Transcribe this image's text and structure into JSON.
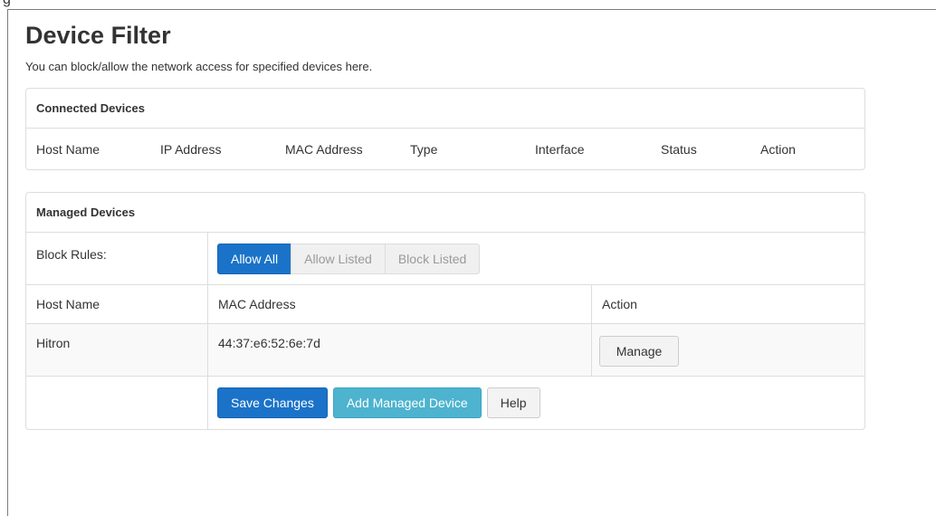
{
  "header": {
    "fragment_text": "g",
    "title": "Device Filter",
    "description": "You can block/allow the network access for specified devices here."
  },
  "connected": {
    "title": "Connected Devices",
    "columns": [
      "Host Name",
      "IP Address",
      "MAC Address",
      "Type",
      "Interface",
      "Status",
      "Action"
    ]
  },
  "managed": {
    "title": "Managed Devices",
    "block_rules_label": "Block Rules:",
    "block_rules_options": [
      "Allow All",
      "Allow Listed",
      "Block Listed"
    ],
    "block_rules_selected": "Allow All",
    "columns": [
      "Host Name",
      "MAC Address",
      "Action"
    ],
    "rows": [
      {
        "host_name": "Hitron",
        "mac": "44:37:e6:52:6e:7d",
        "action_label": "Manage"
      }
    ],
    "buttons": {
      "save": "Save Changes",
      "add": "Add Managed Device",
      "help": "Help"
    }
  },
  "colors": {
    "primary": "#1a73c8",
    "info": "#4db3cf",
    "border": "#dddddd"
  }
}
